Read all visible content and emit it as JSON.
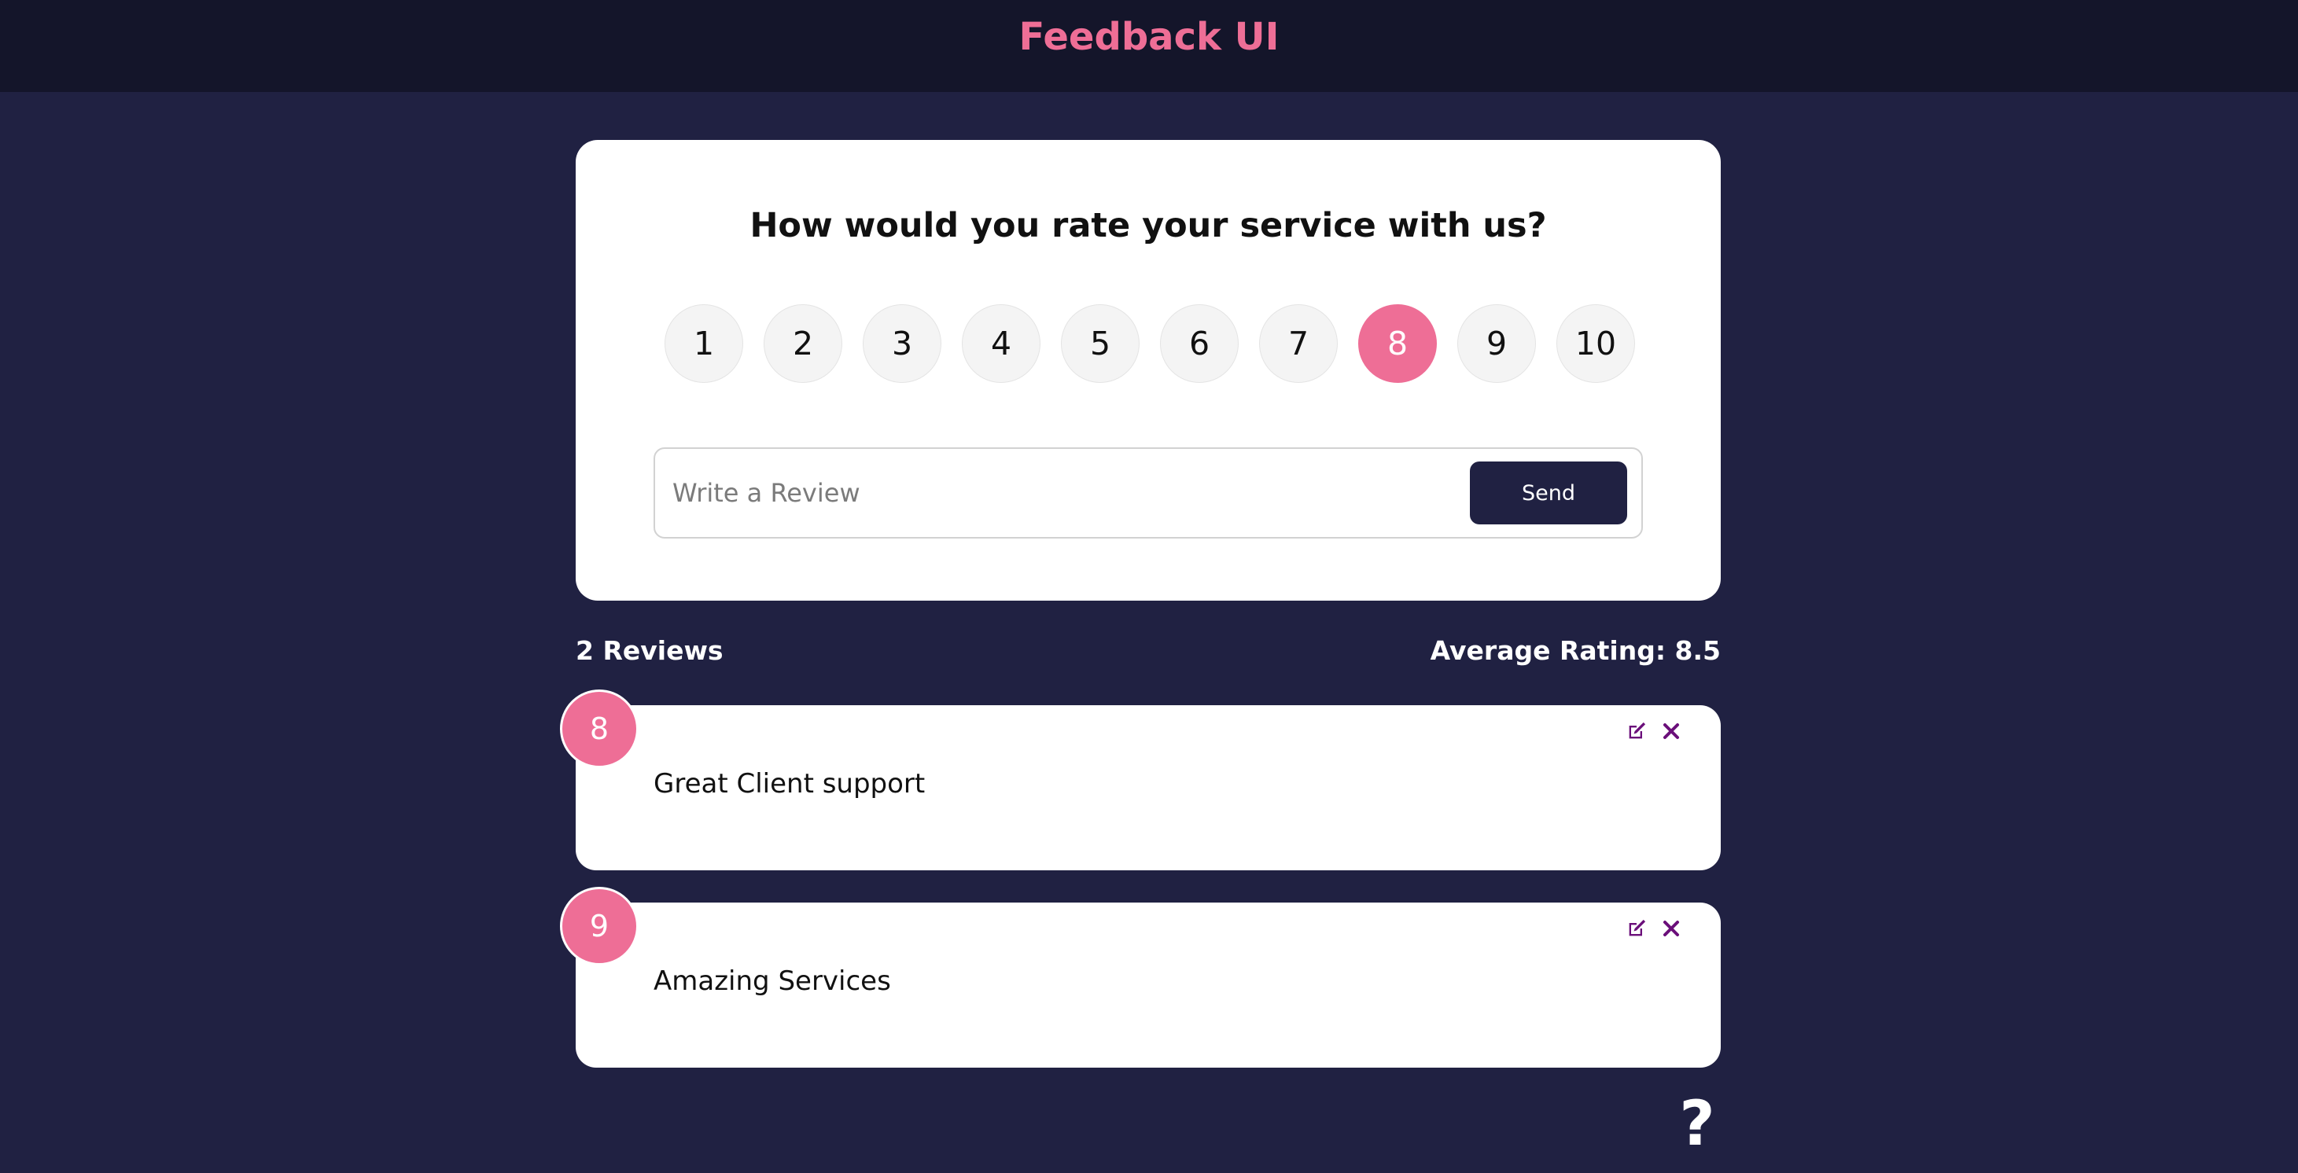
{
  "header": {
    "title": "Feedback UI"
  },
  "form": {
    "question": "How would you rate your service with us?",
    "ratings": [
      "1",
      "2",
      "3",
      "4",
      "5",
      "6",
      "7",
      "8",
      "9",
      "10"
    ],
    "selected_rating": "8",
    "review_placeholder": "Write a Review",
    "send_label": "Send"
  },
  "stats": {
    "count_label": "2 Reviews",
    "average_label": "Average Rating: 8.5"
  },
  "reviews": [
    {
      "rating": "8",
      "text": "Great Client support"
    },
    {
      "rating": "9",
      "text": "Amazing Services"
    }
  ],
  "help": {
    "label": "?"
  },
  "colors": {
    "background": "#202142",
    "header": "#14152a",
    "accent": "#ee6e96",
    "action_icons": "#6b0f7a"
  },
  "icons": {
    "edit": "edit-icon",
    "delete": "close-icon",
    "help": "question-icon"
  }
}
